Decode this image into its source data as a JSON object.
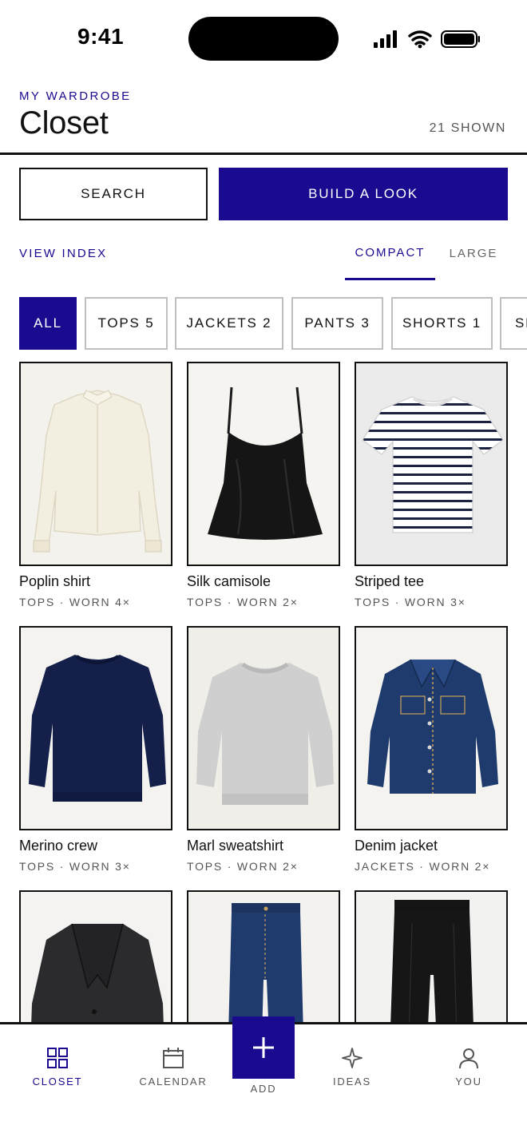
{
  "status_bar": {
    "time": "9:41"
  },
  "header": {
    "eyebrow": "MY WARDROBE",
    "title": "Closet",
    "shown_count": "21 SHOWN"
  },
  "actions": {
    "search_label": "SEARCH",
    "build_label": "BUILD A LOOK"
  },
  "view": {
    "index_label": "VIEW INDEX",
    "compact_label": "COMPACT",
    "large_label": "LARGE",
    "selected": "COMPACT"
  },
  "filters": [
    {
      "label": "ALL",
      "active": true
    },
    {
      "label": "TOPS 5",
      "active": false
    },
    {
      "label": "JACKETS 2",
      "active": false
    },
    {
      "label": "PANTS 3",
      "active": false
    },
    {
      "label": "SHORTS 1",
      "active": false
    },
    {
      "label": "SH",
      "active": false
    }
  ],
  "items": [
    {
      "name": "Poplin shirt",
      "meta": "TOPS · WORN 4×",
      "icon": "shirt-image"
    },
    {
      "name": "Silk camisole",
      "meta": "TOPS · WORN 2×",
      "icon": "camisole-image"
    },
    {
      "name": "Striped tee",
      "meta": "TOPS · WORN 3×",
      "icon": "striped-tee-image"
    },
    {
      "name": "Merino crew",
      "meta": "TOPS · WORN 3×",
      "icon": "sweater-image"
    },
    {
      "name": "Marl sweatshirt",
      "meta": "TOPS · WORN 2×",
      "icon": "sweatshirt-image"
    },
    {
      "name": "Denim jacket",
      "meta": "JACKETS · WORN 2×",
      "icon": "denim-jacket-image"
    },
    {
      "name": "",
      "meta": "",
      "icon": "blazer-image"
    },
    {
      "name": "",
      "meta": "",
      "icon": "jeans-image"
    },
    {
      "name": "",
      "meta": "",
      "icon": "trousers-image"
    }
  ],
  "nav": {
    "closet": "CLOSET",
    "calendar": "CALENDAR",
    "add": "ADD",
    "ideas": "IDEAS",
    "you": "YOU",
    "active": "CLOSET"
  },
  "colors": {
    "accent": "#1a0a8f",
    "ink": "#111111",
    "muted": "#555555",
    "chip_border": "#bfbfbf"
  }
}
